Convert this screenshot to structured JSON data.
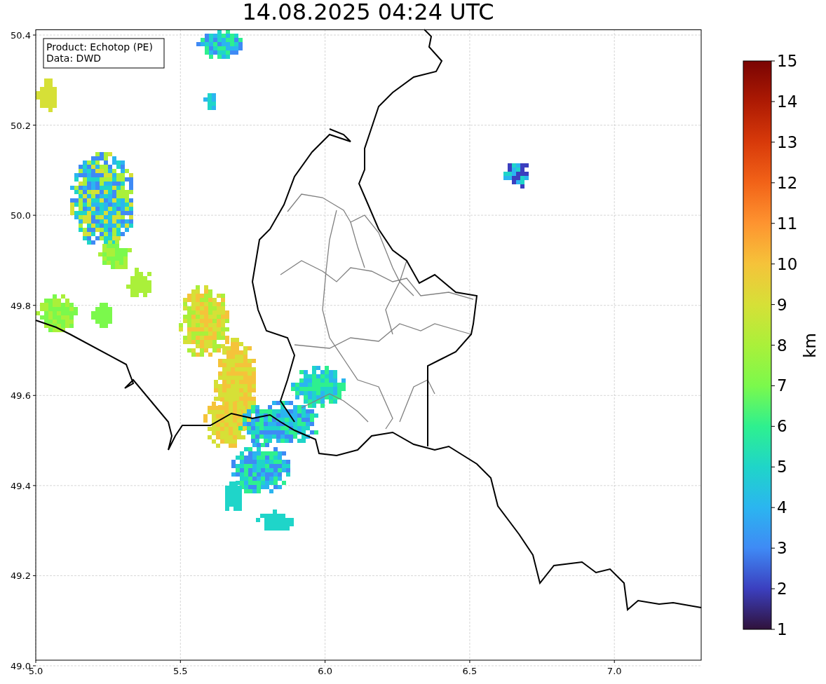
{
  "title": "14.08.2025 04:24 UTC",
  "legend": [
    "Product: Echotop (PE)",
    "Data: DWD"
  ],
  "x_ticks": [
    "5.0",
    "5.5",
    "6.0",
    "6.5",
    "7.0"
  ],
  "y_ticks": [
    "50.4",
    "50.2",
    "50.0",
    "49.8",
    "49.6",
    "49.4",
    "49.2",
    "49.0"
  ],
  "colorbar": {
    "label": "km",
    "ticks": [
      "15",
      "14",
      "13",
      "12",
      "11",
      "10",
      "9",
      "8",
      "7",
      "6",
      "5",
      "4",
      "3",
      "2",
      "1"
    ]
  }
}
